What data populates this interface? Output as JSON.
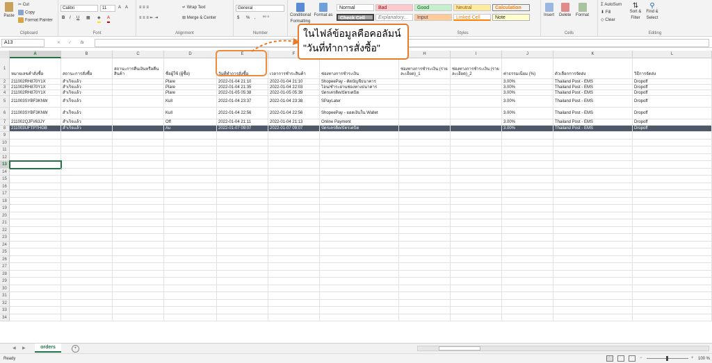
{
  "ribbon": {
    "clipboard": {
      "paste": "Paste",
      "cut": "Cut",
      "copy": "Copy",
      "painter": "Format Painter",
      "label": "Clipboard"
    },
    "font": {
      "name": "Calibri",
      "size": "11",
      "bold": "B",
      "italic": "I",
      "underline": "U",
      "grow": "A",
      "shrink": "A",
      "label": "Font"
    },
    "alignment": {
      "wrap": "Wrap Text",
      "merge": "Merge & Center",
      "label": "Alignment"
    },
    "number": {
      "format": "General",
      "currency": "$",
      "percent": "%",
      "comma": ",",
      "label": "Number"
    },
    "styles": {
      "conditional": "Conditional Formatting",
      "formatas": "Format as",
      "label": "Styles",
      "normal": "Normal",
      "bad": "Bad",
      "good": "Good",
      "neutral": "Neutral",
      "calculation": "Calculation",
      "checkcell": "Check Cell",
      "explanatory": "Explanatory...",
      "input": "Input",
      "linkedcell": "Linked Cell",
      "note": "Note"
    },
    "cells": {
      "insert": "Insert",
      "delete": "Delete",
      "format": "Format",
      "label": "Cells"
    },
    "editing": {
      "autosum": "AutoSum",
      "fill": "Fill",
      "clear": "Clear",
      "sort": "Sort & Filter",
      "find": "Find & Select",
      "label": "Editing"
    }
  },
  "formula_bar": {
    "namebox": "A13",
    "cancel": "✕",
    "enter": "✓",
    "fx": "fx",
    "value": ""
  },
  "columns": [
    "A",
    "B",
    "C",
    "D",
    "E",
    "F",
    "G",
    "H",
    "I",
    "J",
    "K",
    "L"
  ],
  "headers": [
    "หมายเลขคำสั่งซื้อ",
    "สถานะการสั่งซื้อ",
    "สถานะการคืนเงินหรือคืนสินค้า",
    "ชื่อผู้ใช้ (ผู้ซื้อ)",
    "วันที่ทำการสั่งซื้อ",
    "เวลาการชำระสินค้า",
    "ช่องทางการชำระเงิน",
    "ช่องทางการชำระเงิน (รายละเอียด)_1",
    "ช่องทางการชำระเงิน (รายละเอียด)_2",
    "ค่าธรรมเนียม (%)",
    "ตัวเลือกการจัดส่ง",
    "วิธีการจัดส่ง"
  ],
  "data_rows": [
    [
      "211002RH870Y1X",
      "สำเร็จแล้ว",
      "",
      "Plare",
      "2022-01-04 21:10",
      "2022-01-04 21:10",
      "ShopeePay - ตัดบัญชีธนาคาร",
      "",
      "",
      "3.00%",
      "Thailand Post - EMS",
      "Dropoff"
    ],
    [
      "211002RH870Y1X",
      "สำเร็จแล้ว",
      "",
      "Plare",
      "2022-01-04 21:35",
      "2022-01-04 22:03",
      "โอน/ชำระผ่านช่องทางธนาคาร",
      "",
      "",
      "3.00%",
      "Thailand Post - EMS",
      "Dropoff"
    ],
    [
      "211002RH870Y1X",
      "สำเร็จแล้ว",
      "",
      "Plare",
      "2022-01-05 05:38",
      "2022-01-05 05:39",
      "บัตรเครดิต/บัตรเดบิต",
      "",
      "",
      "3.00%",
      "Thailand Post - EMS",
      "Dropoff"
    ],
    [
      "211003SYBF3KNW",
      "สำเร็จแล้ว",
      "",
      "Kull",
      "2022-01-04 23:37",
      "2022-01-04 23:38",
      "SPayLater",
      "",
      "",
      "3.00%",
      "Thailand Post - EMS",
      "Dropoff"
    ],
    [
      "211003SYBF3KNW",
      "สำเร็จแล้ว",
      "",
      "Kull",
      "2022-01-04 22:56",
      "2022-01-04 22:56",
      "ShopeePay - ยอดเงินใน Wallet",
      "",
      "",
      "3.00%",
      "Thailand Post - EMS",
      "Dropoff"
    ],
    [
      "211002QJFV63JY",
      "สำเร็จแล้ว",
      "",
      "Off",
      "2022-01-04 21:11",
      "2022-01-04 21:13",
      "Online Payment",
      "",
      "",
      "3.00%",
      "Thailand Post - EMS",
      "Dropoff"
    ],
    [
      "211003UFTPTHGB",
      "สำเร็จแล้ว",
      "",
      "Au",
      "2022-01-07 09:07",
      "2022-01-07 09:07",
      "บัตรเครดิต/บัตรเดบิต",
      "",
      "",
      "3.00%",
      "Thailand Post - EMS",
      "Dropoff"
    ]
  ],
  "row_numbers": [
    "1",
    "2",
    "3",
    "4",
    "5",
    "6",
    "7",
    "8",
    "9",
    "10",
    "11",
    "12",
    "13",
    "14",
    "15",
    "16",
    "17",
    "18",
    "19",
    "20",
    "21",
    "22",
    "23",
    "24",
    "25",
    "26",
    "27",
    "28",
    "29",
    "30",
    "31",
    "32",
    "33",
    "34"
  ],
  "sheet_tab": "orders",
  "add_sheet": "+",
  "status": {
    "ready": "Ready",
    "zoom": "100 %"
  },
  "callout": {
    "line1": "ในไฟล์ข้อมูลคือคอลัมน์",
    "line2": "\"วันที่ทำการสั่งซื้อ\""
  },
  "colors": {
    "accent": "#217346",
    "callout": "#e87a2c",
    "selected_row": "#4d5868"
  }
}
